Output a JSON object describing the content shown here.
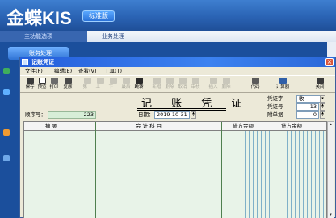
{
  "app": {
    "logo": "金蝶KIS",
    "edition": "标准版",
    "left_tab": "主功能选项",
    "right_tab": "业务处理",
    "nav_tile": "账务处理"
  },
  "window": {
    "title": "记账凭证",
    "close": "×"
  },
  "menu": {
    "file": "文件(F)",
    "edit": "编辑(E)",
    "view": "查看(V)",
    "tools": "工具(T)"
  },
  "toolbar": {
    "save": "保存",
    "preview": "预览",
    "print": "打印",
    "reset": "复原",
    "first": "第一",
    "prev": "上一",
    "next": "下一",
    "last": "最后",
    "jump": "跳转",
    "add": "新增",
    "delete": "删除",
    "cancel": "取消",
    "check": "审核",
    "insert": "插入",
    "remove": "删除",
    "code": "代码",
    "calc": "计算器",
    "close": "关闭"
  },
  "header": {
    "voucher_title": "记 账 凭 证",
    "seq_label": "顺序号：",
    "seq_value": "223",
    "date_label": "日期：",
    "date_value": "2019-10-31",
    "type_label": "凭证字",
    "type_value": "收",
    "num_label": "凭证号",
    "num_value": "13",
    "attach_label": "附单据",
    "attach_value": "0"
  },
  "grid": {
    "col_summary": "摘 要",
    "col_account": "会 计 科 目",
    "col_debit": "借方金额",
    "col_credit": "贷方金额"
  },
  "colors": {
    "title_bar": "#245edb",
    "grid_green": "#e8f3e8",
    "window_bg": "#ece9d8"
  }
}
